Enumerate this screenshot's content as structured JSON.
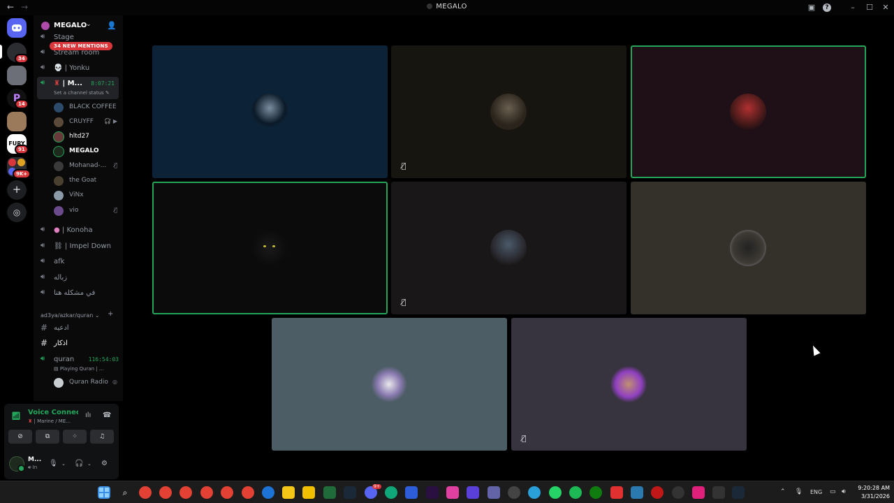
{
  "window": {
    "title": "MEGALO"
  },
  "rail": {
    "badges": [
      "34",
      "14",
      "91",
      "9K+"
    ],
    "unread_letter": "P",
    "fury_label": "FURY"
  },
  "server": {
    "name": "MEGALO",
    "new_mentions": "34 NEW MENTIONS",
    "channels_top": [
      {
        "name": "Stage"
      },
      {
        "name": "Stream room"
      },
      {
        "name": "| Yonku"
      }
    ],
    "active_channel": {
      "name": "| M...",
      "timer": "8:07:21",
      "status": "Set a channel status"
    },
    "members": [
      {
        "name": "BLACK COFFEE"
      },
      {
        "name": "CRUYFF"
      },
      {
        "name": "hltd27"
      },
      {
        "name": "MEGALO"
      },
      {
        "name": "Mohanad-..."
      },
      {
        "name": "the Goat"
      },
      {
        "name": "ViNx"
      },
      {
        "name": "vio"
      }
    ],
    "channels_mid": [
      {
        "name": "| Konoha"
      },
      {
        "name": "| Impel Down"
      },
      {
        "name": "afk"
      },
      {
        "name": "زباله"
      },
      {
        "name": "في مشكله هنا"
      }
    ],
    "category": "ad3ya/azkar/quran",
    "text_channels": [
      {
        "name": "ادعيه"
      },
      {
        "name": "اذكار"
      }
    ],
    "quran_channel": {
      "name": "quran",
      "timer": "116:54:03",
      "activity": "Playing Quran | ..."
    },
    "quran_member": {
      "name": "Quran Radio"
    }
  },
  "voice_panel": {
    "title": "Voice Connected",
    "subtitle": "| Marine / ME...",
    "user_name": "M...",
    "user_status": "In"
  },
  "tiles_count": 8,
  "taskbar": {
    "lang": "ENG",
    "time": "9:20:28 AM",
    "date": "3/31/2026",
    "discord_badge": "9+"
  },
  "colors": {
    "accent_green": "#23a55a",
    "mention_red": "#da373c"
  }
}
